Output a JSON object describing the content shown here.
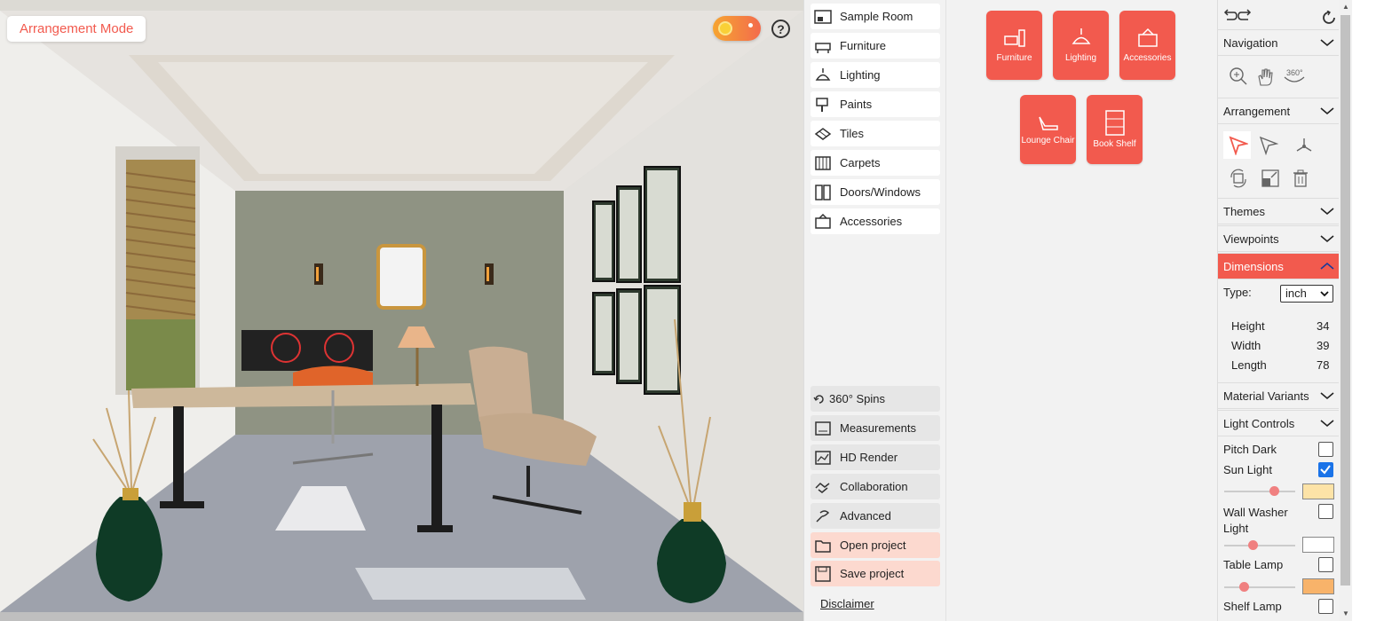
{
  "viewport": {
    "mode_label": "Arrangement Mode",
    "help_glyph": "?"
  },
  "menu": {
    "top_items": [
      {
        "label": "Sample Room",
        "icon": "sample-room-icon"
      },
      {
        "label": "Furniture",
        "icon": "furniture-icon"
      },
      {
        "label": "Lighting",
        "icon": "lighting-icon"
      },
      {
        "label": "Paints",
        "icon": "paints-icon"
      },
      {
        "label": "Tiles",
        "icon": "tiles-icon"
      },
      {
        "label": "Carpets",
        "icon": "carpets-icon"
      },
      {
        "label": "Doors/Windows",
        "icon": "doors-windows-icon"
      },
      {
        "label": "Accessories",
        "icon": "accessories-icon"
      }
    ],
    "bottom_items": [
      {
        "label": "360° Spins",
        "icon": "spin-icon"
      },
      {
        "label": "Measurements",
        "icon": "measurements-icon"
      },
      {
        "label": "HD Render",
        "icon": "hd-render-icon"
      },
      {
        "label": "Collaboration",
        "icon": "collaboration-icon"
      },
      {
        "label": "Advanced",
        "icon": "advanced-icon"
      },
      {
        "label": "Open project",
        "icon": "folder-icon"
      },
      {
        "label": "Save project",
        "icon": "save-icon"
      }
    ],
    "disclaimer": "Disclaimer"
  },
  "catalog": {
    "tiles": [
      {
        "label": "Furniture",
        "icon": "furniture-icon"
      },
      {
        "label": "Lighting",
        "icon": "lighting-icon"
      },
      {
        "label": "Accessories",
        "icon": "accessories-icon"
      },
      {
        "label": "Lounge Chair",
        "icon": "lounge-chair-icon"
      },
      {
        "label": "Book Shelf",
        "icon": "book-shelf-icon"
      }
    ],
    "accent": "#f25a4e"
  },
  "panel": {
    "sections": {
      "navigation": "Navigation",
      "arrangement": "Arrangement",
      "themes": "Themes",
      "viewpoints": "Viewpoints",
      "dimensions": "Dimensions",
      "material_variants": "Material Variants",
      "light_controls": "Light Controls"
    },
    "navigation_tools": [
      "zoom-icon",
      "hand-icon",
      "rotate-360-icon"
    ],
    "rotate_label": "360°",
    "arrangement_tools": [
      "select-icon",
      "move-icon",
      "axis-icon",
      "rotate-icon",
      "scale-icon",
      "delete-icon"
    ],
    "dimensions": {
      "type_label": "Type:",
      "type_value": "inch",
      "rows": [
        {
          "label": "Height",
          "value": "34"
        },
        {
          "label": "Width",
          "value": "39"
        },
        {
          "label": "Length",
          "value": "78"
        }
      ]
    },
    "lights": [
      {
        "label": "Pitch Dark",
        "checked": false
      },
      {
        "label": "Sun Light",
        "checked": true,
        "slider": 0.7,
        "color": "#fde3a7"
      },
      {
        "label": "Wall Washer Light",
        "checked": false,
        "slider": 0.4,
        "color": "#ffffff"
      },
      {
        "label": "Table Lamp",
        "checked": false,
        "slider": 0.28,
        "color": "#f8b36a"
      },
      {
        "label": "Shelf Lamp",
        "checked": false
      }
    ]
  }
}
